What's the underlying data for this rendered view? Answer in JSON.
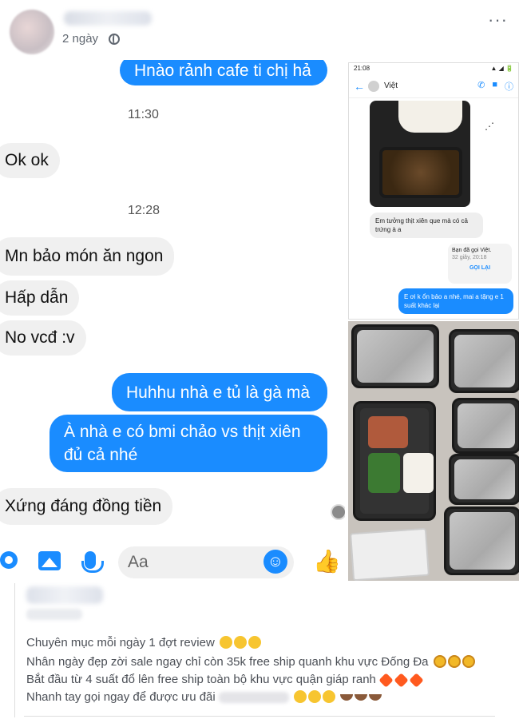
{
  "post": {
    "time": "2 ngày",
    "more": "···"
  },
  "chat": {
    "messages": {
      "m1": "Hnào rảnh cafe ti chị hả",
      "t1": "11:30",
      "m2": "Ok ok",
      "t2": "12:28",
      "m3": "Mn bảo món ăn ngon",
      "m4": "Hấp dẫn",
      "m5": "No vcđ :v",
      "m6": "Huhhu nhà e tủ là gà mà",
      "m7a": "À nhà e có bmi chảo vs thịt xiên",
      "m7b": "đủ cả nhé",
      "m8": "Xứng đáng đồng tiền"
    },
    "input_placeholder": "Aa"
  },
  "phone": {
    "status_time": "21:08",
    "status_right": "▲ ◢ 🔋",
    "contact_name": "Việt",
    "msg_in": "Em tưởng thịt xiên que mà có cả trứng à a",
    "call_title": "Bạn đã gọi Việt.",
    "call_sub": "32 giây, 20:18",
    "call_button": "GỌI LẠI",
    "msg_out": "E ơi k ổn bảo a nhé, mai a tặng e 1 suất khác lại"
  },
  "caption": {
    "line1": "Chuyên mục mỗi ngày 1 đợt review",
    "line2": "Nhân ngày đẹp zời sale ngay chỉ còn 35k free ship quanh khu vực Đống Đa",
    "line3": "Bắt đầu từ 4 suất đổ lên free ship toàn bộ khu vực quận giáp ranh",
    "line4": "Nhanh tay gọi ngay để được ưu đãi"
  }
}
